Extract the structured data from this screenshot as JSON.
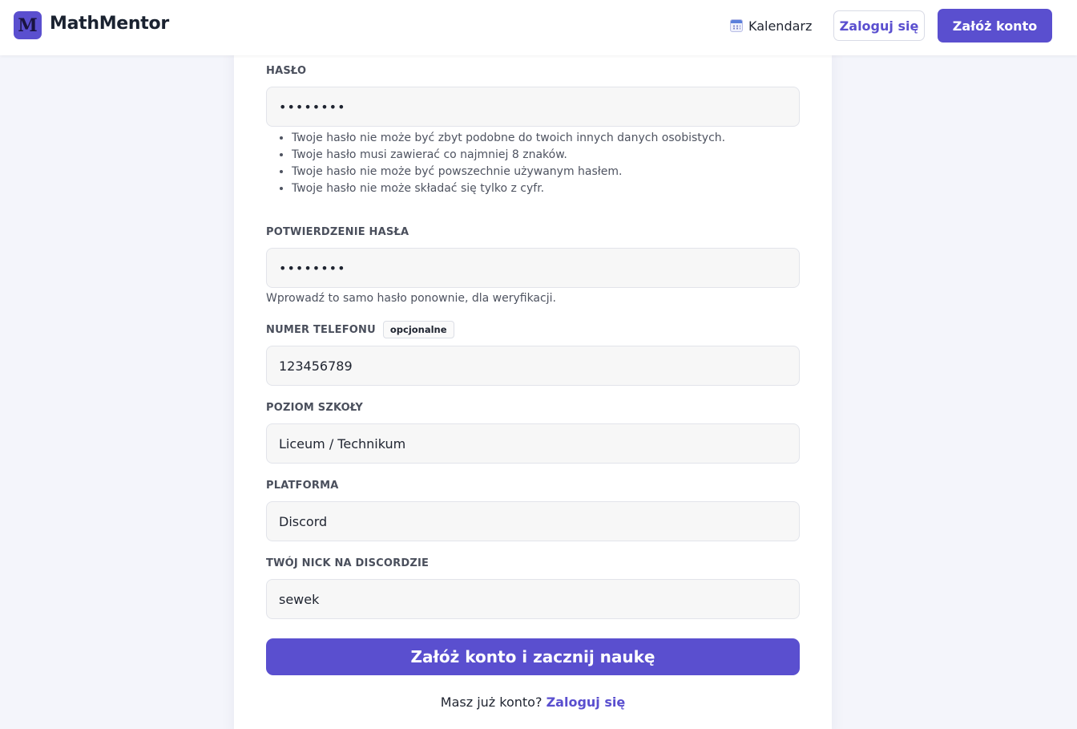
{
  "header": {
    "logo_letter": "M",
    "brand": "MathMentor",
    "calendar_icon": "calendar-icon",
    "calendar_label": "Kalendarz",
    "login_label": "Zaloguj się",
    "register_label": "Załóż konto"
  },
  "form": {
    "password": {
      "label": "HASŁO",
      "value": "••••••••",
      "hints": [
        "Twoje hasło nie może być zbyt podobne do twoich innych danych osobistych.",
        "Twoje hasło musi zawierać co najmniej 8 znaków.",
        "Twoje hasło nie może być powszechnie używanym hasłem.",
        "Twoje hasło nie może składać się tylko z cyfr."
      ]
    },
    "password_confirm": {
      "label": "POTWIERDZENIE HASŁA",
      "value": "••••••••",
      "helper": "Wprowadź to samo hasło ponownie, dla weryfikacji."
    },
    "phone": {
      "label": "NUMER TELEFONU",
      "badge": "opcjonalne",
      "value": "123456789"
    },
    "school_level": {
      "label": "POZIOM SZKOŁY",
      "value": "Liceum / Technikum"
    },
    "platform": {
      "label": "PLATFORMA",
      "value": "Discord"
    },
    "discord_nick": {
      "label": "TWÓJ NICK NA DISCORDZIE",
      "value": "sewek"
    },
    "submit_label": "Załóż konto i zacznij naukę",
    "footer_text": "Masz już konto?",
    "footer_link": "Zaloguj się"
  },
  "colors": {
    "accent": "#5a4fcf",
    "background": "#f4f5fb",
    "input_bg": "#f7f7f7"
  }
}
